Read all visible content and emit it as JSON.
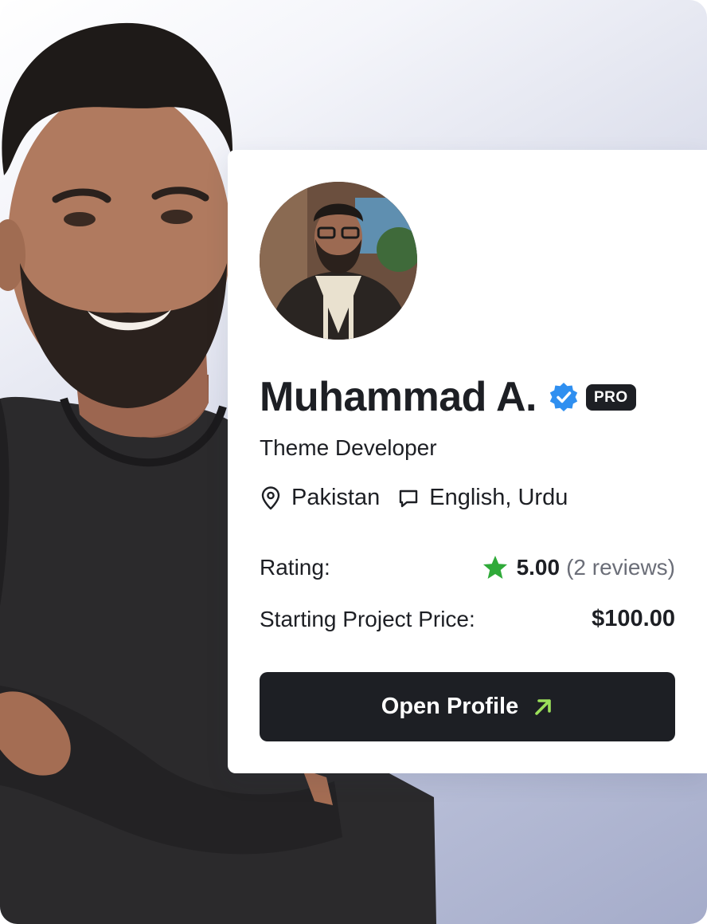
{
  "profile": {
    "name": "Muhammad A.",
    "badge": "PRO",
    "role": "Theme Developer",
    "location": "Pakistan",
    "languages": "English, Urdu",
    "rating_label": "Rating:",
    "rating_value": "5.00",
    "reviews": "(2 reviews)",
    "price_label": "Starting Project Price:",
    "price_value": "$100.00",
    "cta_label": "Open Profile"
  },
  "icons": {
    "verified": "verified-check-icon",
    "location": "map-pin-icon",
    "languages": "chat-bubble-icon",
    "rating": "star-icon",
    "cta": "arrow-up-right-icon"
  },
  "colors": {
    "primary_dark": "#1d1f24",
    "verified_blue": "#2f8ff0",
    "star_green": "#2faa39",
    "arrow_green": "#9be05a",
    "muted_text": "#6b6e78"
  }
}
